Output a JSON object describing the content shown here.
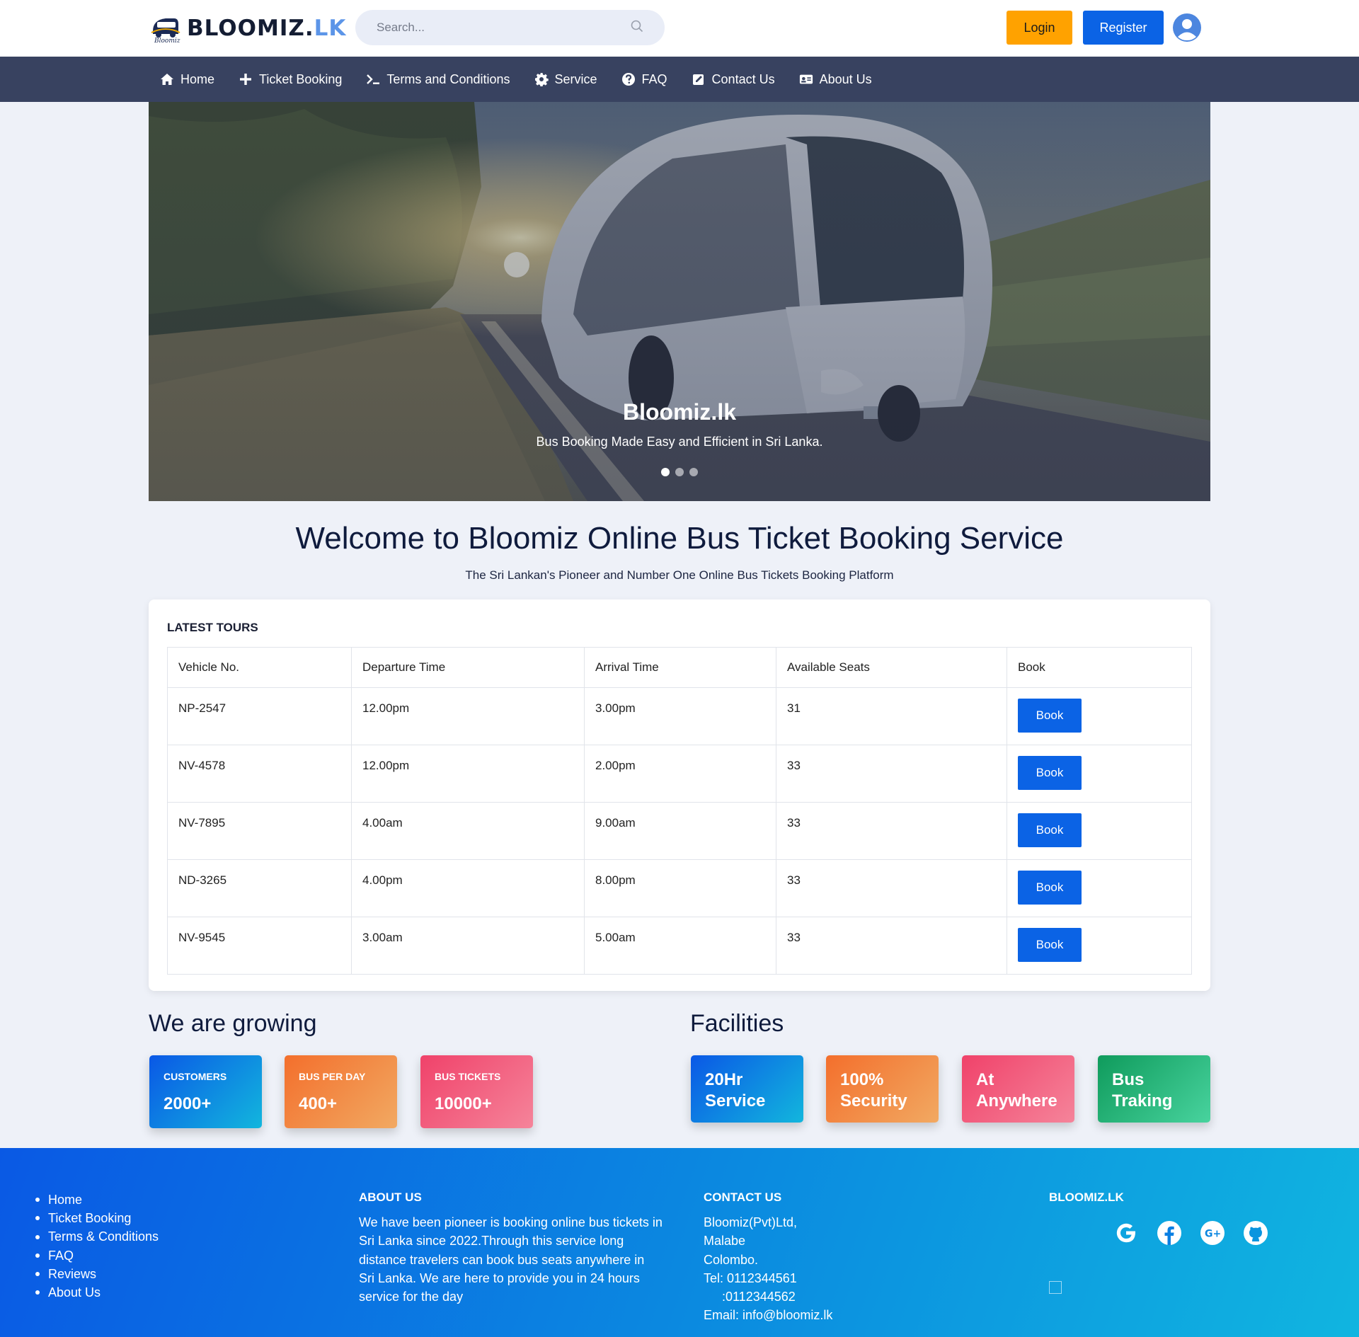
{
  "header": {
    "logo_text": "BLOOMIZ.",
    "logo_suffix": "LK",
    "logo_small": "Bloomiz",
    "search_placeholder": "Search...",
    "login_label": "Login",
    "register_label": "Register"
  },
  "nav": [
    {
      "label": "Home",
      "icon": "home-icon"
    },
    {
      "label": "Ticket Booking",
      "icon": "plus-icon"
    },
    {
      "label": "Terms and Conditions",
      "icon": "terminal-icon"
    },
    {
      "label": "Service",
      "icon": "gear-icon"
    },
    {
      "label": "FAQ",
      "icon": "question-circle-icon"
    },
    {
      "label": "Contact Us",
      "icon": "edit-square-icon"
    },
    {
      "label": "About Us",
      "icon": "id-card-icon"
    }
  ],
  "hero": {
    "title": "Bloomiz.lk",
    "subtitle": "Bus Booking Made Easy and Efficient in Sri Lanka.",
    "slides": 3,
    "active_slide": 1
  },
  "welcome": {
    "title": "Welcome to Bloomiz Online Bus Ticket Booking Service",
    "subtitle": "The Sri Lankan's Pioneer and Number One Online Bus Tickets Booking Platform"
  },
  "tours": {
    "title": "LATEST TOURS",
    "columns": [
      "Vehicle No.",
      "Departure Time",
      "Arrival Time",
      "Available Seats",
      "Book"
    ],
    "book_label": "Book",
    "rows": [
      [
        "NP-2547",
        "12.00pm",
        "3.00pm",
        "31"
      ],
      [
        "NV-4578",
        "12.00pm",
        "2.00pm",
        "33"
      ],
      [
        "NV-7895",
        "4.00am",
        "9.00am",
        "33"
      ],
      [
        "ND-3265",
        "4.00pm",
        "8.00pm",
        "33"
      ],
      [
        "NV-9545",
        "3.00am",
        "5.00am",
        "33"
      ]
    ]
  },
  "growing": {
    "title": "We are growing",
    "stats": [
      {
        "label": "CUSTOMERS",
        "value": "2000+"
      },
      {
        "label": "BUS PER DAY",
        "value": "400+"
      },
      {
        "label": "BUS TICKETS",
        "value": "10000+"
      }
    ]
  },
  "facilities": {
    "title": "Facilities",
    "items": [
      {
        "line1": "20Hr",
        "line2": "Service"
      },
      {
        "line1": "100%",
        "line2": "Security"
      },
      {
        "line1": "At",
        "line2": "Anywhere"
      },
      {
        "line1": "Bus",
        "line2": "Traking"
      }
    ]
  },
  "footer": {
    "links": [
      "Home",
      "Ticket Booking",
      "Terms & Conditions",
      "FAQ",
      "Reviews",
      "About Us"
    ],
    "about_title": "ABOUT US",
    "about_text": "We have been pioneer is booking online bus tickets in Sri Lanka since 2022.Through this service long distance travelers can book bus seats anywhere in Sri Lanka. We are here to provide you in 24 hours service for the day",
    "contact_title": "CONTACT US",
    "contact_lines": [
      "Bloomiz(Pvt)Ltd,",
      "Malabe",
      "Colombo.",
      "Tel: 0112344561",
      ":0112344562",
      "Email: info@bloomiz.lk"
    ],
    "brand_title": "BLOOMIZ.LK",
    "social_icons": [
      "google-icon",
      "facebook-icon",
      "google-plus-icon",
      "github-icon"
    ]
  },
  "colors": {
    "primary": "#0b63e5",
    "login": "#ffa200",
    "nav_bg": "#384260",
    "page_bg": "#eef1f8"
  }
}
